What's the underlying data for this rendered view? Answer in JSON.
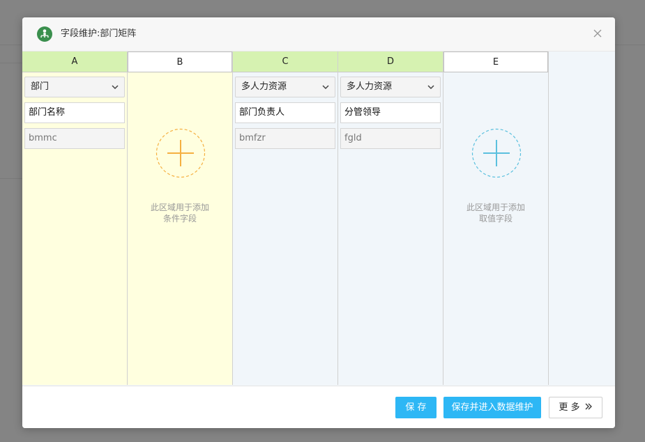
{
  "dialog": {
    "title": "字段维护:部门矩阵",
    "colors": {
      "accent": "#2db7f5",
      "condition_header": "#d6f2b1",
      "condition_bg": "#ffffdf",
      "value_bg": "#f1f6fa",
      "icon_green": "#3a8f4d",
      "plus_orange": "#f5b041",
      "plus_blue": "#5bc0de"
    }
  },
  "columns": [
    {
      "letter": "A",
      "select_value": "部门",
      "field_name": "部门名称",
      "field_code": "bmmc"
    },
    {
      "letter": "B",
      "hint_line1": "此区域用于添加",
      "hint_line2": "条件字段"
    },
    {
      "letter": "C",
      "select_value": "多人力资源",
      "field_name": "部门负责人",
      "field_code": "bmfzr"
    },
    {
      "letter": "D",
      "select_value": "多人力资源",
      "field_name": "分管领导",
      "field_code": "fgld"
    },
    {
      "letter": "E",
      "hint_line1": "此区域用于添加",
      "hint_line2": "取值字段"
    }
  ],
  "footer": {
    "save_label": "保 存",
    "save_enter_label": "保存并进入数据维护",
    "more_label": "更 多"
  }
}
